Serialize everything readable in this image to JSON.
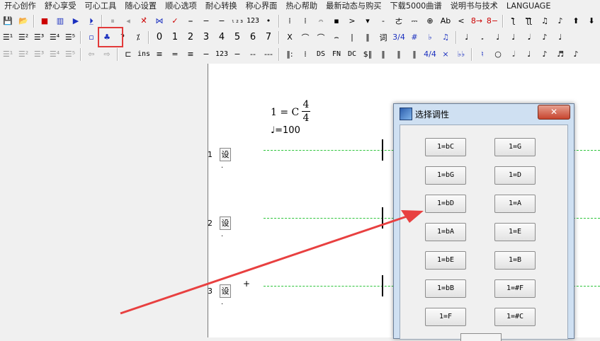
{
  "menu": [
    "开心创作",
    "舒心享受",
    "可心工具",
    "随心设置",
    "顺心选项",
    "耐心转换",
    "称心界面",
    "热心帮助",
    "最新动态与购买",
    "下载5000曲谱",
    "说明书与技术",
    "LANGUAGE"
  ],
  "toolbar1": [
    {
      "t": "💾",
      "c": "",
      "n": "save-icon"
    },
    {
      "t": "📂",
      "c": "",
      "n": "open-icon"
    },
    {
      "t": "■",
      "c": "red",
      "n": "stop-icon"
    },
    {
      "t": "▥",
      "c": "blue",
      "n": "piano-icon"
    },
    {
      "t": "▶",
      "c": "blue",
      "n": "play-icon"
    },
    {
      "t": "⏵̲",
      "c": "blue",
      "n": "play-from-icon"
    },
    {
      "t": "⏸",
      "c": "grey",
      "n": "pause-icon"
    },
    {
      "t": "◂",
      "c": "grey",
      "n": "back-icon"
    },
    {
      "t": "✕̂",
      "c": "red",
      "n": "mark-x-icon"
    },
    {
      "t": "⋈",
      "c": "blue",
      "n": "link-icon"
    },
    {
      "t": "✓",
      "c": "red",
      "n": "check-icon"
    },
    {
      "t": "⎯",
      "c": "",
      "n": "line-icon"
    },
    {
      "t": "−",
      "c": "",
      "n": "dash-icon"
    },
    {
      "t": "−",
      "c": "",
      "n": "dash2-icon"
    },
    {
      "t": "ₗ₂₃",
      "c": "mono",
      "n": "num-small-icon"
    },
    {
      "t": "123",
      "c": "mono",
      "n": "num-123-icon"
    },
    {
      "t": "•",
      "c": "",
      "n": "dot-icon"
    },
    {
      "t": "⁞",
      "c": "",
      "n": "colon-icon"
    },
    {
      "t": "⁞",
      "c": "",
      "n": "colon2-icon"
    },
    {
      "t": "𝄐",
      "c": "",
      "n": "fermata-icon"
    },
    {
      "t": "▪",
      "c": "",
      "n": "square-icon"
    },
    {
      "t": ">",
      "c": "",
      "n": "accent-icon"
    },
    {
      "t": "▾",
      "c": "",
      "n": "down-tri-icon"
    },
    {
      "t": "-",
      "c": "",
      "n": "hyphen-icon"
    },
    {
      "t": "ㄜ",
      "c": "",
      "n": "turn-icon"
    },
    {
      "t": "⎓",
      "c": "",
      "n": "tenuto-icon"
    },
    {
      "t": "⊕",
      "c": "",
      "n": "coda-icon"
    },
    {
      "t": "Ab",
      "c": "",
      "n": "ab-icon"
    },
    {
      "t": "<",
      "c": "",
      "n": "cresc-icon"
    },
    {
      "t": "8→",
      "c": "red",
      "n": "octave-up-icon"
    },
    {
      "t": "8−",
      "c": "red",
      "n": "octave-down-icon"
    },
    {
      "t": "ƪ",
      "c": "",
      "n": "grace-icon"
    },
    {
      "t": "ƪƪ",
      "c": "",
      "n": "grace2-icon"
    },
    {
      "t": "♫",
      "c": "",
      "n": "beam-icon"
    },
    {
      "t": "♪",
      "c": "",
      "n": "eighth-icon"
    },
    {
      "t": "⬆",
      "c": "",
      "n": "arrow-up-icon"
    },
    {
      "t": "⬇",
      "c": "",
      "n": "arrow-down-icon"
    }
  ],
  "toolbar2": [
    {
      "t": "☰¹",
      "c": "",
      "n": "staff1-icon"
    },
    {
      "t": "☰²",
      "c": "",
      "n": "staff2-icon"
    },
    {
      "t": "☰³",
      "c": "",
      "n": "staff3-icon"
    },
    {
      "t": "☰⁴",
      "c": "",
      "n": "staff4-icon"
    },
    {
      "t": "☰⁵",
      "c": "",
      "n": "staff5-icon"
    },
    {
      "t": "▫",
      "c": "blue",
      "n": "rect-icon"
    },
    {
      "t": "♣",
      "c": "blue",
      "n": "key-signature-icon"
    },
    {
      "t": "ʔ",
      "c": "",
      "n": "hook-icon"
    },
    {
      "t": "⁒",
      "c": "",
      "n": "percent-icon"
    },
    {
      "t": "0",
      "c": "big",
      "n": "digit-0"
    },
    {
      "t": "1",
      "c": "big",
      "n": "digit-1"
    },
    {
      "t": "2",
      "c": "big",
      "n": "digit-2"
    },
    {
      "t": "3",
      "c": "big",
      "n": "digit-3"
    },
    {
      "t": "4",
      "c": "big",
      "n": "digit-4"
    },
    {
      "t": "5",
      "c": "big",
      "n": "digit-5"
    },
    {
      "t": "6",
      "c": "big",
      "n": "digit-6"
    },
    {
      "t": "7",
      "c": "big",
      "n": "digit-7"
    },
    {
      "t": "X",
      "c": "",
      "n": "x-icon"
    },
    {
      "t": "⌒",
      "c": "",
      "n": "slur-icon"
    },
    {
      "t": "⌒",
      "c": "",
      "n": "tie-icon"
    },
    {
      "t": "⌢",
      "c": "",
      "n": "arc-icon"
    },
    {
      "t": "|",
      "c": "",
      "n": "bar-icon"
    },
    {
      "t": "‖",
      "c": "",
      "n": "double-bar-icon"
    },
    {
      "t": "词",
      "c": "",
      "n": "lyrics-icon"
    },
    {
      "t": "3/4",
      "c": "blue",
      "n": "time-sig-icon"
    },
    {
      "t": "#",
      "c": "blue",
      "n": "sharp-icon"
    },
    {
      "t": "♭",
      "c": "blue",
      "n": "flat-icon"
    },
    {
      "t": "♫",
      "c": "blue",
      "n": "notes-icon"
    },
    {
      "t": "♩",
      "c": "",
      "n": "quarter-icon"
    },
    {
      "t": "𝅗",
      "c": "",
      "n": "half-rest-icon"
    },
    {
      "t": "♩",
      "c": "",
      "n": "quarter2-icon"
    },
    {
      "t": "♩",
      "c": "",
      "n": "quarter3-icon"
    },
    {
      "t": "𝅘𝅥",
      "c": "",
      "n": "note-icon"
    },
    {
      "t": "♪",
      "c": "",
      "n": "eighth2-icon"
    },
    {
      "t": "♩",
      "c": "",
      "n": "note2-icon"
    }
  ],
  "toolbar3": [
    {
      "t": "☰¹",
      "c": "grey",
      "n": "t3-staff1-icon"
    },
    {
      "t": "☰²",
      "c": "grey",
      "n": "t3-staff2-icon"
    },
    {
      "t": "☰³",
      "c": "grey",
      "n": "t3-staff3-icon"
    },
    {
      "t": "☰⁴",
      "c": "grey",
      "n": "t3-staff4-icon"
    },
    {
      "t": "☰⁵",
      "c": "grey",
      "n": "t3-staff5-icon"
    },
    {
      "t": "⇦",
      "c": "grey",
      "n": "left-arrow-icon"
    },
    {
      "t": "⇨",
      "c": "grey",
      "n": "right-arrow-icon"
    },
    {
      "t": "⊏",
      "c": "",
      "n": "bracket-icon"
    },
    {
      "t": "ins",
      "c": "mono",
      "n": "ins-icon"
    },
    {
      "t": "≡",
      "c": "",
      "n": "equal1-icon"
    },
    {
      "t": "=",
      "c": "",
      "n": "equal2-icon"
    },
    {
      "t": "≡",
      "c": "",
      "n": "equal3-icon"
    },
    {
      "t": "−",
      "c": "",
      "n": "minus-icon"
    },
    {
      "t": "123",
      "c": "mono",
      "n": "t3-123-icon"
    },
    {
      "t": "−",
      "c": "",
      "n": "minus2-icon"
    },
    {
      "t": "--",
      "c": "",
      "n": "dd-icon"
    },
    {
      "t": "---",
      "c": "",
      "n": "ddd-icon"
    },
    {
      "t": "‖:",
      "c": "",
      "n": "repeat-start-icon"
    },
    {
      "t": "⁞",
      "c": "",
      "n": "repeat-dots-icon"
    },
    {
      "t": "DS",
      "c": "mono",
      "n": "ds-icon"
    },
    {
      "t": "FN",
      "c": "mono",
      "n": "fn-icon"
    },
    {
      "t": "DC",
      "c": "mono",
      "n": "dc-icon"
    },
    {
      "t": "$‖",
      "c": "",
      "n": "segno-icon"
    },
    {
      "t": "‖",
      "c": "",
      "n": "dbl-icon"
    },
    {
      "t": "‖",
      "c": "",
      "n": "dbl2-icon"
    },
    {
      "t": "‖",
      "c": "",
      "n": "dbl3-icon"
    },
    {
      "t": "4/4",
      "c": "blue",
      "n": "t3-time-icon"
    },
    {
      "t": "×",
      "c": "blue",
      "n": "double-sharp-icon"
    },
    {
      "t": "♭♭",
      "c": "blue",
      "n": "double-flat-icon"
    },
    {
      "t": "♮",
      "c": "blue",
      "n": "natural-icon"
    },
    {
      "t": "○",
      "c": "",
      "n": "whole-icon"
    },
    {
      "t": "𝅗𝅥",
      "c": "",
      "n": "half-icon"
    },
    {
      "t": "♩",
      "c": "",
      "n": "t3-quarter-icon"
    },
    {
      "t": "♪",
      "c": "",
      "n": "t3-eighth-icon"
    },
    {
      "t": "♬",
      "c": "",
      "n": "t3-16th-icon"
    },
    {
      "t": "♪",
      "c": "",
      "n": "t3-note-icon"
    }
  ],
  "score": {
    "key": "1 = C",
    "time_num": "4",
    "time_den": "4",
    "tempo_note": "♩",
    "tempo": "=100",
    "rows": [
      {
        "num": "1",
        "btn": "设"
      },
      {
        "num": "2",
        "btn": "设"
      },
      {
        "num": "3",
        "btn": "设"
      }
    ],
    "cursor": "+"
  },
  "dialog": {
    "title": "选择调性",
    "close": "✕",
    "left_keys": [
      "1=bC",
      "1=bG",
      "1=bD",
      "1=bA",
      "1=bE",
      "1=bB",
      "1=F"
    ],
    "right_keys": [
      "1=G",
      "1=D",
      "1=A",
      "1=E",
      "1=B",
      "1=#F",
      "1=#C"
    ]
  },
  "colors": {
    "highlight": "#e23a3a",
    "arrow": "#e84040",
    "staff_dash": "#2cc43a",
    "dialog_frame": "#cfe0f2"
  }
}
